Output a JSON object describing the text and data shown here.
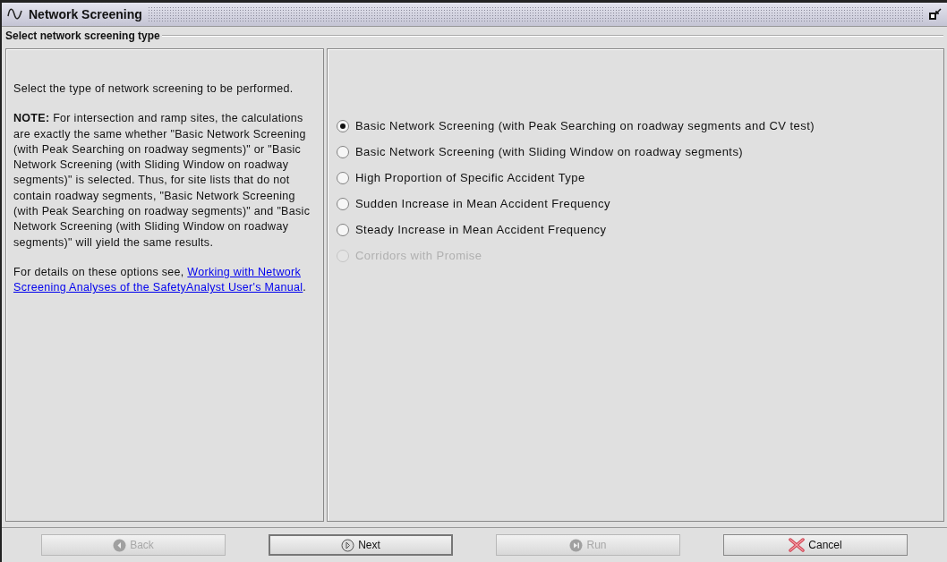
{
  "window": {
    "title": "Network Screening"
  },
  "section": {
    "title": "Select network screening type"
  },
  "help": {
    "paragraphs": [
      "Select the type of network screening to be performed.",
      "**NOTE:** For intersection and ramp sites, the calculations are exactly the same whether \"Basic Network Screening (with Peak Searching on roadway segments)\" or \"Basic Network Screening (with Sliding Window on roadway segments)\" is selected. Thus, for site lists that do not contain roadway segments, \"Basic Network Screening (with Peak Searching on roadway segments)\" and \"Basic Network Screening (with Sliding Window on roadway segments)\" will yield the same results."
    ],
    "details_prefix": "For details on these options see, ",
    "details_link": "Working with Network Screening Analyses of the SafetyAnalyst User's Manual",
    "details_suffix": "."
  },
  "options": [
    {
      "label": "Basic Network Screening (with Peak Searching on roadway segments and CV test)",
      "selected": true,
      "disabled": false
    },
    {
      "label": "Basic Network Screening (with Sliding Window on roadway segments)",
      "selected": false,
      "disabled": false
    },
    {
      "label": "High Proportion of Specific Accident Type",
      "selected": false,
      "disabled": false
    },
    {
      "label": "Sudden Increase in Mean Accident Frequency",
      "selected": false,
      "disabled": false
    },
    {
      "label": "Steady Increase in Mean Accident Frequency",
      "selected": false,
      "disabled": false
    },
    {
      "label": "Corridors with Promise",
      "selected": false,
      "disabled": true
    }
  ],
  "buttons": [
    {
      "label": "Back",
      "kind": "back",
      "disabled": true,
      "focused": false
    },
    {
      "label": "Next",
      "kind": "next",
      "disabled": false,
      "focused": true
    },
    {
      "label": "Run",
      "kind": "run",
      "disabled": true,
      "focused": false
    },
    {
      "label": "Cancel",
      "kind": "cancel",
      "disabled": false,
      "focused": false
    }
  ]
}
